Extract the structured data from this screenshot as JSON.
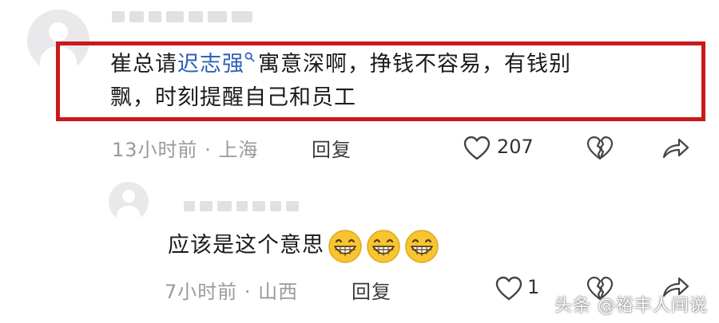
{
  "comment1": {
    "text_line1_prefix": "崔总请",
    "mention": "迟志强",
    "text_line1_suffix": "寓意深啊，挣钱不容易，有钱别",
    "text_line2": "飘，时刻提醒自己和员工",
    "time_location": "13小时前 · 上海",
    "reply_label": "回复",
    "like_count": "207"
  },
  "comment2": {
    "text": "应该是这个意思",
    "emoji_count": 3,
    "time_location": "7小时前 · 山西",
    "reply_label": "回复",
    "like_count": "1"
  },
  "watermark": "头条 @裕丰人间说",
  "colors": {
    "highlight_border": "#c91a1a",
    "mention": "#2f62b8",
    "meta_text": "#9a9a9a"
  },
  "icons": [
    "avatar-placeholder-icon",
    "search-icon",
    "heart-outline-icon",
    "broken-heart-icon",
    "share-arrow-icon",
    "grinning-emoji-icon"
  ]
}
